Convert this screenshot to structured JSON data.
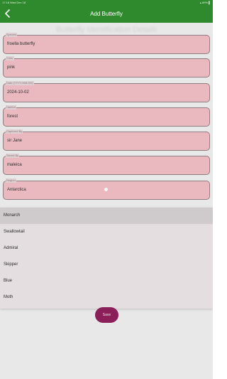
{
  "status_bar": {
    "time_date": "17:18   Wed Dec 18",
    "battery": "▴ 89% ▌"
  },
  "app_bar": {
    "title": "Add Butterfly",
    "back_icon": "arrow-left-icon"
  },
  "form": {
    "ghost_heading": "Butterfly Identification Details",
    "fields": [
      {
        "label": "Species",
        "value": "froella butterfly"
      },
      {
        "label": "Color",
        "value": "pink"
      },
      {
        "label": "Date (YYYY-MM-DD)",
        "value": "2024-10-02"
      },
      {
        "label": "Habitat",
        "value": "forest"
      },
      {
        "label": "Captured By",
        "value": "sir Jane"
      },
      {
        "label": "Saved By",
        "value": "maleica"
      },
      {
        "label": "Region",
        "value": "Antarctica"
      }
    ],
    "save_label": "Save"
  },
  "dropdown": {
    "selected": "Monarch",
    "options": [
      "Monarch",
      "Swallowtail",
      "Admiral",
      "Skipper",
      "Blue",
      "Moth"
    ]
  },
  "colors": {
    "app_bar": "#2e8a2c",
    "field_fill": "#e9b9bf",
    "save_button": "#8b1f59"
  }
}
